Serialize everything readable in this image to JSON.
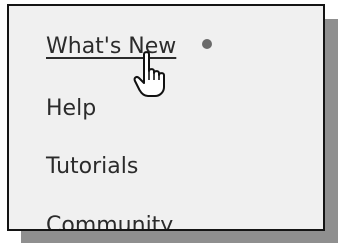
{
  "menu": {
    "items": [
      {
        "label": "What's New",
        "hovered": true,
        "has_new_indicator": true
      },
      {
        "label": "Help",
        "hovered": false
      },
      {
        "label": "Tutorials",
        "hovered": false
      },
      {
        "label": "Community",
        "hovered": false
      }
    ],
    "new_indicator_color": "#6a6a6a"
  },
  "cursor": {
    "icon": "hand-pointer-icon"
  }
}
